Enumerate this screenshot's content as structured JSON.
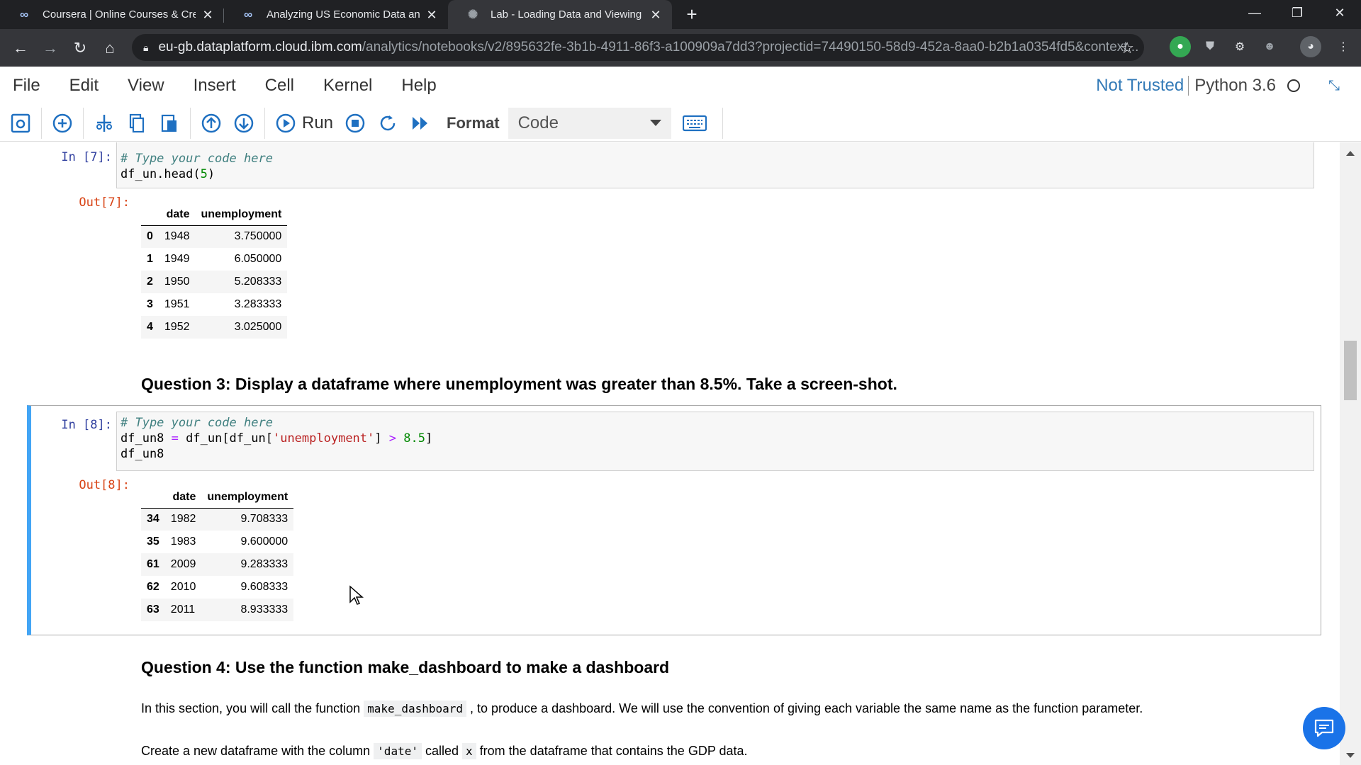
{
  "browser": {
    "tabs": [
      {
        "title": "Coursera | Online Courses & Creden",
        "favicon": "coursera-icon"
      },
      {
        "title": "Analyzing US Economic Data and Bu",
        "favicon": "coursera-icon"
      },
      {
        "title": "Lab - Loading Data and Viewing Dat",
        "favicon": "loading-spinner-icon"
      }
    ],
    "url_host": "eu-gb.dataplatform.cloud.ibm.com",
    "url_path": "/analytics/notebooks/v2/895632fe-3b1b-4911-86f3-a100909a7dd3?projectid=74490150-58d9-452a-8aa0-b2b1a0354fd5&context..."
  },
  "menubar": {
    "items": [
      "File",
      "Edit",
      "View",
      "Insert",
      "Cell",
      "Kernel",
      "Help"
    ],
    "not_trusted": "Not Trusted",
    "kernel": "Python 3.6"
  },
  "toolbar": {
    "run_label": "Run",
    "format_label": "Format",
    "format_value": "Code"
  },
  "cells": {
    "cell7": {
      "in_prompt": "In [7]:",
      "out_prompt": "Out[7]:",
      "code_comment": "# Type your code here",
      "code_line2_a": "df_un.head(",
      "code_line2_num": "5",
      "code_line2_b": ")",
      "table": {
        "headers": [
          "",
          "date",
          "unemployment"
        ],
        "rows": [
          [
            "0",
            "1948",
            "3.750000"
          ],
          [
            "1",
            "1949",
            "6.050000"
          ],
          [
            "2",
            "1950",
            "5.208333"
          ],
          [
            "3",
            "1951",
            "3.283333"
          ],
          [
            "4",
            "1952",
            "3.025000"
          ]
        ]
      }
    },
    "question3": "Question 3: Display a dataframe where unemployment was greater than 8.5%. Take a screen-shot.",
    "cell8": {
      "in_prompt": "In [8]:",
      "out_prompt": "Out[8]:",
      "code_comment": "# Type your code here",
      "code_l2_a": "df_un8 ",
      "code_l2_eq": "=",
      "code_l2_b": " df_un[df_un[",
      "code_l2_str": "'unemployment'",
      "code_l2_c": "] ",
      "code_l2_gt": ">",
      "code_l2_sp": " ",
      "code_l2_num": "8.5",
      "code_l2_d": "]",
      "code_line3": "df_un8",
      "table": {
        "headers": [
          "",
          "date",
          "unemployment"
        ],
        "rows": [
          [
            "34",
            "1982",
            "9.708333"
          ],
          [
            "35",
            "1983",
            "9.600000"
          ],
          [
            "61",
            "2009",
            "9.283333"
          ],
          [
            "62",
            "2010",
            "9.608333"
          ],
          [
            "63",
            "2011",
            "8.933333"
          ]
        ]
      }
    },
    "question4": "Question 4: Use the function make_dashboard to make a dashboard",
    "para1_a": "In this section, you will call the function ",
    "para1_code": "make_dashboard",
    "para1_b": " , to produce a dashboard. We will use the convention of giving each variable the same name as the function parameter.",
    "para2_a": "Create a new dataframe with the column ",
    "para2_code1": "'date'",
    "para2_b": " called ",
    "para2_code2": "x",
    "para2_c": " from the dataframe that contains the GDP data."
  }
}
